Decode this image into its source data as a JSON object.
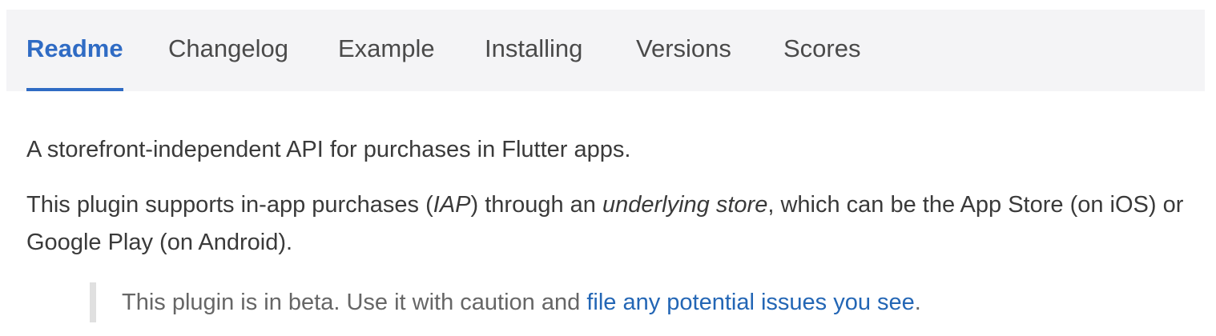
{
  "tabs": [
    {
      "label": "Readme",
      "active": true
    },
    {
      "label": "Changelog",
      "active": false
    },
    {
      "label": "Example",
      "active": false
    },
    {
      "label": "Installing",
      "active": false
    },
    {
      "label": "Versions",
      "active": false
    },
    {
      "label": "Scores",
      "active": false
    }
  ],
  "readme": {
    "intro": "A storefront-independent API for purchases in Flutter apps.",
    "para2": {
      "part1": "This plugin supports in-app purchases (",
      "iap": "IAP",
      "part2": ") through an ",
      "underlying_store": "underlying store",
      "part3": ", which can be the App Store (on iOS) or Google Play (on Android)."
    },
    "note": {
      "text": "This plugin is in beta. Use it with caution and ",
      "link": "file any potential issues you see",
      "end": "."
    }
  },
  "colors": {
    "accent": "#2f6bc4",
    "link": "#2366b5",
    "tab_bar_bg": "#f4f4f6",
    "blockquote_border": "#e0e0e0"
  }
}
